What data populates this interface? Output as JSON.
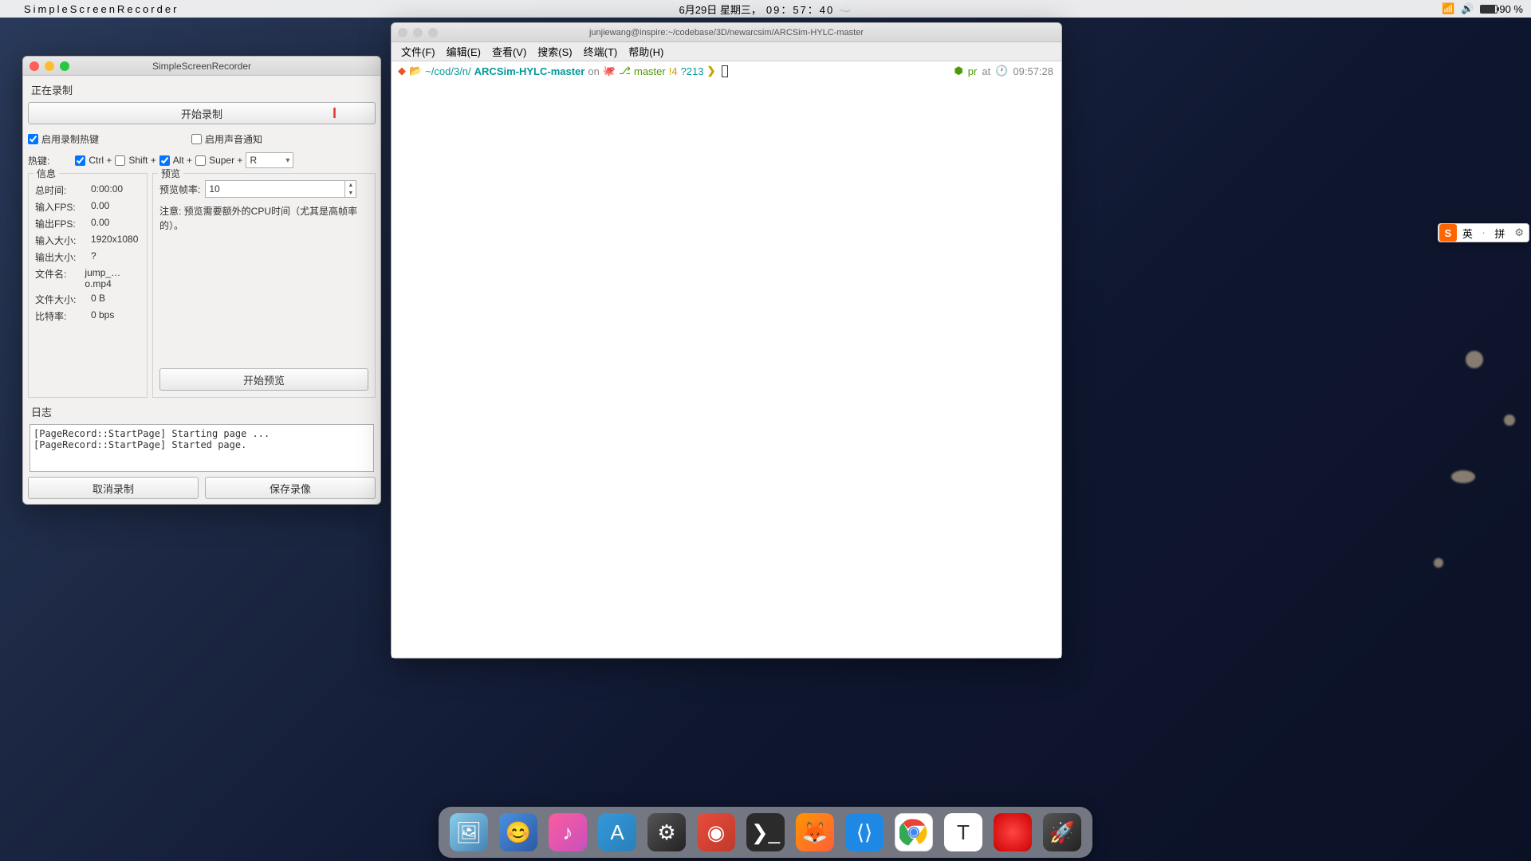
{
  "menubar": {
    "appname": "SimpleScreenRecorder",
    "date": "6月29日 星期三，",
    "time": "09：57：40",
    "battery_pct": "90 %"
  },
  "ssr": {
    "title": "SimpleScreenRecorder",
    "section_record": "正在录制",
    "start_button": "开始录制",
    "enable_hotkey": "启用录制热键",
    "enable_sound": "启用声音通知",
    "hotkey_label": "热键:",
    "mod_ctrl": "Ctrl +",
    "mod_shift": "Shift +",
    "mod_alt": "Alt +",
    "mod_super": "Super +",
    "key": "R",
    "info_title": "信息",
    "preview_title": "预览",
    "info": {
      "total_time_lbl": "总时间:",
      "total_time": "0:00:00",
      "fps_in_lbl": "输入FPS:",
      "fps_in": "0.00",
      "fps_out_lbl": "输出FPS:",
      "fps_out": "0.00",
      "size_in_lbl": "输入大小:",
      "size_in": "1920x1080",
      "size_out_lbl": "输出大小:",
      "size_out": "?",
      "filename_lbl": "文件名:",
      "filename": "jump_…o.mp4",
      "filesize_lbl": "文件大小:",
      "filesize": "0 B",
      "bitrate_lbl": "比特率:",
      "bitrate": "0 bps"
    },
    "preview_fps_lbl": "预览帧率:",
    "preview_fps": "10",
    "preview_note": "注意: 预览需要额外的CPU时间（尤其是高帧率的）。",
    "start_preview": "开始预览",
    "log_title": "日志",
    "log": "[PageRecord::StartPage] Starting page ...\n[PageRecord::StartPage] Started page.",
    "cancel": "取消录制",
    "save": "保存录像"
  },
  "terminal": {
    "title": "junjiewang@inspire:~/codebase/3D/newarcsim/ARCSim-HYLC-master",
    "menus": [
      "文件(F)",
      "编辑(E)",
      "查看(V)",
      "搜索(S)",
      "终端(T)",
      "帮助(H)"
    ],
    "path_prefix": "~/cod/3/n/",
    "path_repo": "ARCSim-HYLC-master",
    "on": "on",
    "branch": "master",
    "dirty": "!4",
    "untracked": "?213",
    "rprompt_pr": "pr",
    "rprompt_at": "at",
    "rprompt_time": "09:57:28"
  },
  "ime": {
    "lang": "英",
    "mode": "拼"
  },
  "dock": [
    "preview",
    "finder",
    "music",
    "appstore",
    "settings",
    "cloud",
    "terminal",
    "firefox",
    "vscode",
    "chrome",
    "typora",
    "record",
    "launch"
  ]
}
